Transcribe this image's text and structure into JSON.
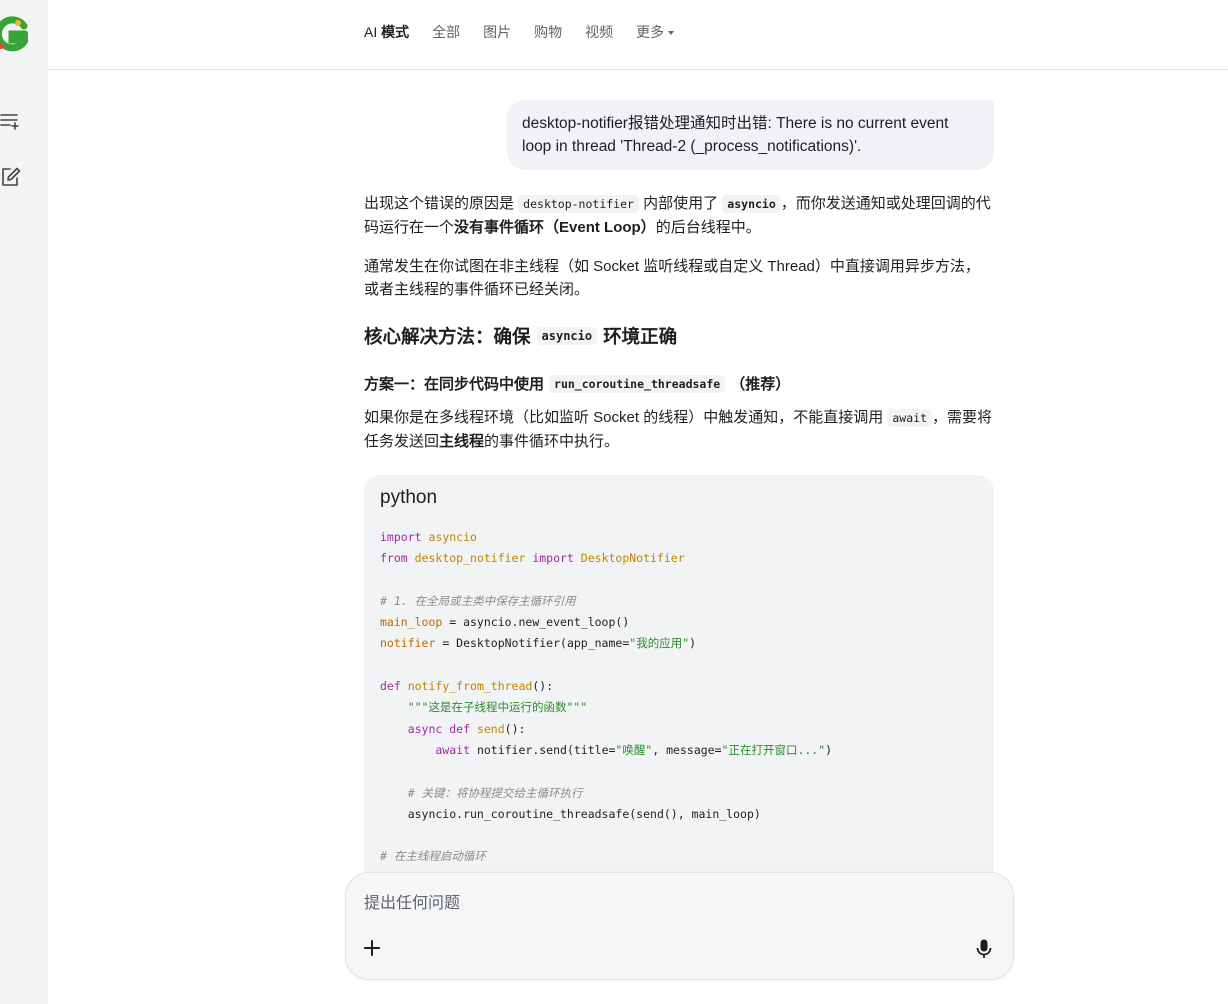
{
  "nav": {
    "tabs": [
      {
        "label_prefix": "AI ",
        "label_bold": "模式"
      },
      {
        "label": "全部"
      },
      {
        "label": "图片"
      },
      {
        "label": "购物"
      },
      {
        "label": "视频"
      },
      {
        "label": "更多"
      }
    ]
  },
  "user_message": "desktop-notifier报错处理通知时出错: There is no current event loop in thread 'Thread-2 (_process_notifications)'.",
  "answer": {
    "p1": {
      "a": "出现这个错误的原因是 ",
      "code1": "desktop-notifier",
      "b": " 内部使用了 ",
      "code2": "asyncio",
      "c": "，而你发送通知或处理回调的代码运行在一个",
      "bold": "没有事件循环（Event Loop）",
      "d": "的后台线程中。"
    },
    "p2": "通常发生在你试图在非主线程（如 Socket 监听线程或自定义 Thread）中直接调用异步方法，或者主线程的事件循环已经关闭。",
    "h2": {
      "a": "核心解决方法：确保",
      "code": "asyncio",
      "b": "环境正确"
    },
    "h3": {
      "a": "方案一：在同步代码中使用",
      "code": "run_coroutine_threadsafe",
      "b": "（推荐）"
    },
    "p3": {
      "a": "如果你是在多线程环境（比如监听 Socket 的线程）中触发通知，不能直接调用 ",
      "code": "await",
      "b": "，需要将任务发送回",
      "bold": "主线程",
      "c": "的事件循环中执行。"
    },
    "code_lang": "python",
    "code": {
      "l1_kw": "import",
      "l1_mod": " asyncio",
      "l2_kw": "from",
      "l2_mod": " desktop_notifier ",
      "l2_kw2": "import",
      "l2_cls": " DesktopNotifier",
      "l4_cm": "# 1. 在全局或主类中保存主循环引用",
      "l5_var": "main_loop",
      "l5_rest": " = asyncio.new_event_loop()",
      "l6_var": "notifier",
      "l6_rest": " = DesktopNotifier(app_name=",
      "l6_str": "\"我的应用\"",
      "l6_end": ")",
      "l8_kw": "def",
      "l8_fn": " notify_from_thread",
      "l8_rest": "():",
      "l9_str": "    \"\"\"这是在子线程中运行的函数\"\"\"",
      "l10_kw": "    async def",
      "l10_fn": " send",
      "l10_rest": "():",
      "l11_kw": "        await",
      "l11_rest": " notifier.send(title=",
      "l11_str1": "\"唤醒\"",
      "l11_mid": ", message=",
      "l11_str2": "\"正在打开窗口...\"",
      "l11_end": ")",
      "l13_cm": "    # 关键：将协程提交给主循环执行",
      "l14": "    asyncio.run_coroutine_threadsafe(send(), main_loop)",
      "l16_cm": "# 在主线程启动循环"
    }
  },
  "input": {
    "placeholder": "提出任何问题"
  }
}
